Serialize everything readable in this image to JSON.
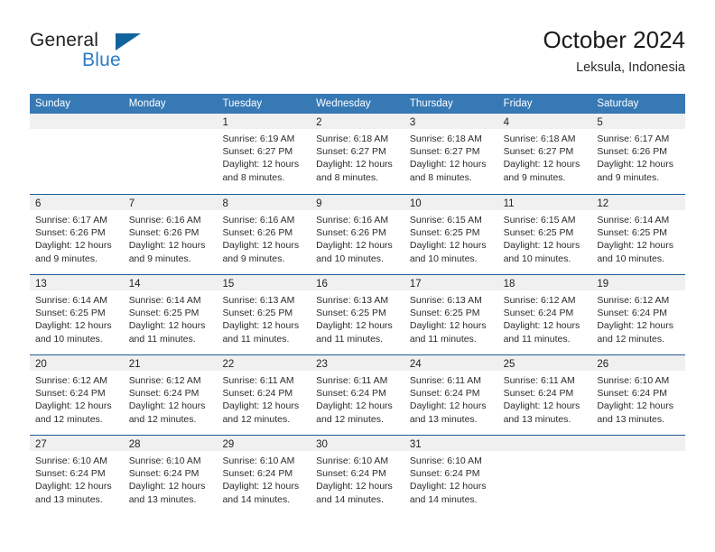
{
  "brand": {
    "word_one": "General",
    "word_two": "Blue",
    "triangle_color": "#11639e",
    "blue_color": "#2b7cc4"
  },
  "header": {
    "title": "October 2024",
    "subtitle": "Leksula, Indonesia"
  },
  "theme": {
    "header_blue": "#3679b5",
    "row_divider": "#1f5c96",
    "day_band": "#f0f0f0"
  },
  "weekdays": [
    "Sunday",
    "Monday",
    "Tuesday",
    "Wednesday",
    "Thursday",
    "Friday",
    "Saturday"
  ],
  "weeks": [
    [
      {
        "day": "",
        "lines": []
      },
      {
        "day": "",
        "lines": []
      },
      {
        "day": "1",
        "lines": [
          "Sunrise: 6:19 AM",
          "Sunset: 6:27 PM",
          "Daylight: 12 hours",
          "and 8 minutes."
        ]
      },
      {
        "day": "2",
        "lines": [
          "Sunrise: 6:18 AM",
          "Sunset: 6:27 PM",
          "Daylight: 12 hours",
          "and 8 minutes."
        ]
      },
      {
        "day": "3",
        "lines": [
          "Sunrise: 6:18 AM",
          "Sunset: 6:27 PM",
          "Daylight: 12 hours",
          "and 8 minutes."
        ]
      },
      {
        "day": "4",
        "lines": [
          "Sunrise: 6:18 AM",
          "Sunset: 6:27 PM",
          "Daylight: 12 hours",
          "and 9 minutes."
        ]
      },
      {
        "day": "5",
        "lines": [
          "Sunrise: 6:17 AM",
          "Sunset: 6:26 PM",
          "Daylight: 12 hours",
          "and 9 minutes."
        ]
      }
    ],
    [
      {
        "day": "6",
        "lines": [
          "Sunrise: 6:17 AM",
          "Sunset: 6:26 PM",
          "Daylight: 12 hours",
          "and 9 minutes."
        ]
      },
      {
        "day": "7",
        "lines": [
          "Sunrise: 6:16 AM",
          "Sunset: 6:26 PM",
          "Daylight: 12 hours",
          "and 9 minutes."
        ]
      },
      {
        "day": "8",
        "lines": [
          "Sunrise: 6:16 AM",
          "Sunset: 6:26 PM",
          "Daylight: 12 hours",
          "and 9 minutes."
        ]
      },
      {
        "day": "9",
        "lines": [
          "Sunrise: 6:16 AM",
          "Sunset: 6:26 PM",
          "Daylight: 12 hours",
          "and 10 minutes."
        ]
      },
      {
        "day": "10",
        "lines": [
          "Sunrise: 6:15 AM",
          "Sunset: 6:25 PM",
          "Daylight: 12 hours",
          "and 10 minutes."
        ]
      },
      {
        "day": "11",
        "lines": [
          "Sunrise: 6:15 AM",
          "Sunset: 6:25 PM",
          "Daylight: 12 hours",
          "and 10 minutes."
        ]
      },
      {
        "day": "12",
        "lines": [
          "Sunrise: 6:14 AM",
          "Sunset: 6:25 PM",
          "Daylight: 12 hours",
          "and 10 minutes."
        ]
      }
    ],
    [
      {
        "day": "13",
        "lines": [
          "Sunrise: 6:14 AM",
          "Sunset: 6:25 PM",
          "Daylight: 12 hours",
          "and 10 minutes."
        ]
      },
      {
        "day": "14",
        "lines": [
          "Sunrise: 6:14 AM",
          "Sunset: 6:25 PM",
          "Daylight: 12 hours",
          "and 11 minutes."
        ]
      },
      {
        "day": "15",
        "lines": [
          "Sunrise: 6:13 AM",
          "Sunset: 6:25 PM",
          "Daylight: 12 hours",
          "and 11 minutes."
        ]
      },
      {
        "day": "16",
        "lines": [
          "Sunrise: 6:13 AM",
          "Sunset: 6:25 PM",
          "Daylight: 12 hours",
          "and 11 minutes."
        ]
      },
      {
        "day": "17",
        "lines": [
          "Sunrise: 6:13 AM",
          "Sunset: 6:25 PM",
          "Daylight: 12 hours",
          "and 11 minutes."
        ]
      },
      {
        "day": "18",
        "lines": [
          "Sunrise: 6:12 AM",
          "Sunset: 6:24 PM",
          "Daylight: 12 hours",
          "and 11 minutes."
        ]
      },
      {
        "day": "19",
        "lines": [
          "Sunrise: 6:12 AM",
          "Sunset: 6:24 PM",
          "Daylight: 12 hours",
          "and 12 minutes."
        ]
      }
    ],
    [
      {
        "day": "20",
        "lines": [
          "Sunrise: 6:12 AM",
          "Sunset: 6:24 PM",
          "Daylight: 12 hours",
          "and 12 minutes."
        ]
      },
      {
        "day": "21",
        "lines": [
          "Sunrise: 6:12 AM",
          "Sunset: 6:24 PM",
          "Daylight: 12 hours",
          "and 12 minutes."
        ]
      },
      {
        "day": "22",
        "lines": [
          "Sunrise: 6:11 AM",
          "Sunset: 6:24 PM",
          "Daylight: 12 hours",
          "and 12 minutes."
        ]
      },
      {
        "day": "23",
        "lines": [
          "Sunrise: 6:11 AM",
          "Sunset: 6:24 PM",
          "Daylight: 12 hours",
          "and 12 minutes."
        ]
      },
      {
        "day": "24",
        "lines": [
          "Sunrise: 6:11 AM",
          "Sunset: 6:24 PM",
          "Daylight: 12 hours",
          "and 13 minutes."
        ]
      },
      {
        "day": "25",
        "lines": [
          "Sunrise: 6:11 AM",
          "Sunset: 6:24 PM",
          "Daylight: 12 hours",
          "and 13 minutes."
        ]
      },
      {
        "day": "26",
        "lines": [
          "Sunrise: 6:10 AM",
          "Sunset: 6:24 PM",
          "Daylight: 12 hours",
          "and 13 minutes."
        ]
      }
    ],
    [
      {
        "day": "27",
        "lines": [
          "Sunrise: 6:10 AM",
          "Sunset: 6:24 PM",
          "Daylight: 12 hours",
          "and 13 minutes."
        ]
      },
      {
        "day": "28",
        "lines": [
          "Sunrise: 6:10 AM",
          "Sunset: 6:24 PM",
          "Daylight: 12 hours",
          "and 13 minutes."
        ]
      },
      {
        "day": "29",
        "lines": [
          "Sunrise: 6:10 AM",
          "Sunset: 6:24 PM",
          "Daylight: 12 hours",
          "and 14 minutes."
        ]
      },
      {
        "day": "30",
        "lines": [
          "Sunrise: 6:10 AM",
          "Sunset: 6:24 PM",
          "Daylight: 12 hours",
          "and 14 minutes."
        ]
      },
      {
        "day": "31",
        "lines": [
          "Sunrise: 6:10 AM",
          "Sunset: 6:24 PM",
          "Daylight: 12 hours",
          "and 14 minutes."
        ]
      },
      {
        "day": "",
        "lines": []
      },
      {
        "day": "",
        "lines": []
      }
    ]
  ]
}
